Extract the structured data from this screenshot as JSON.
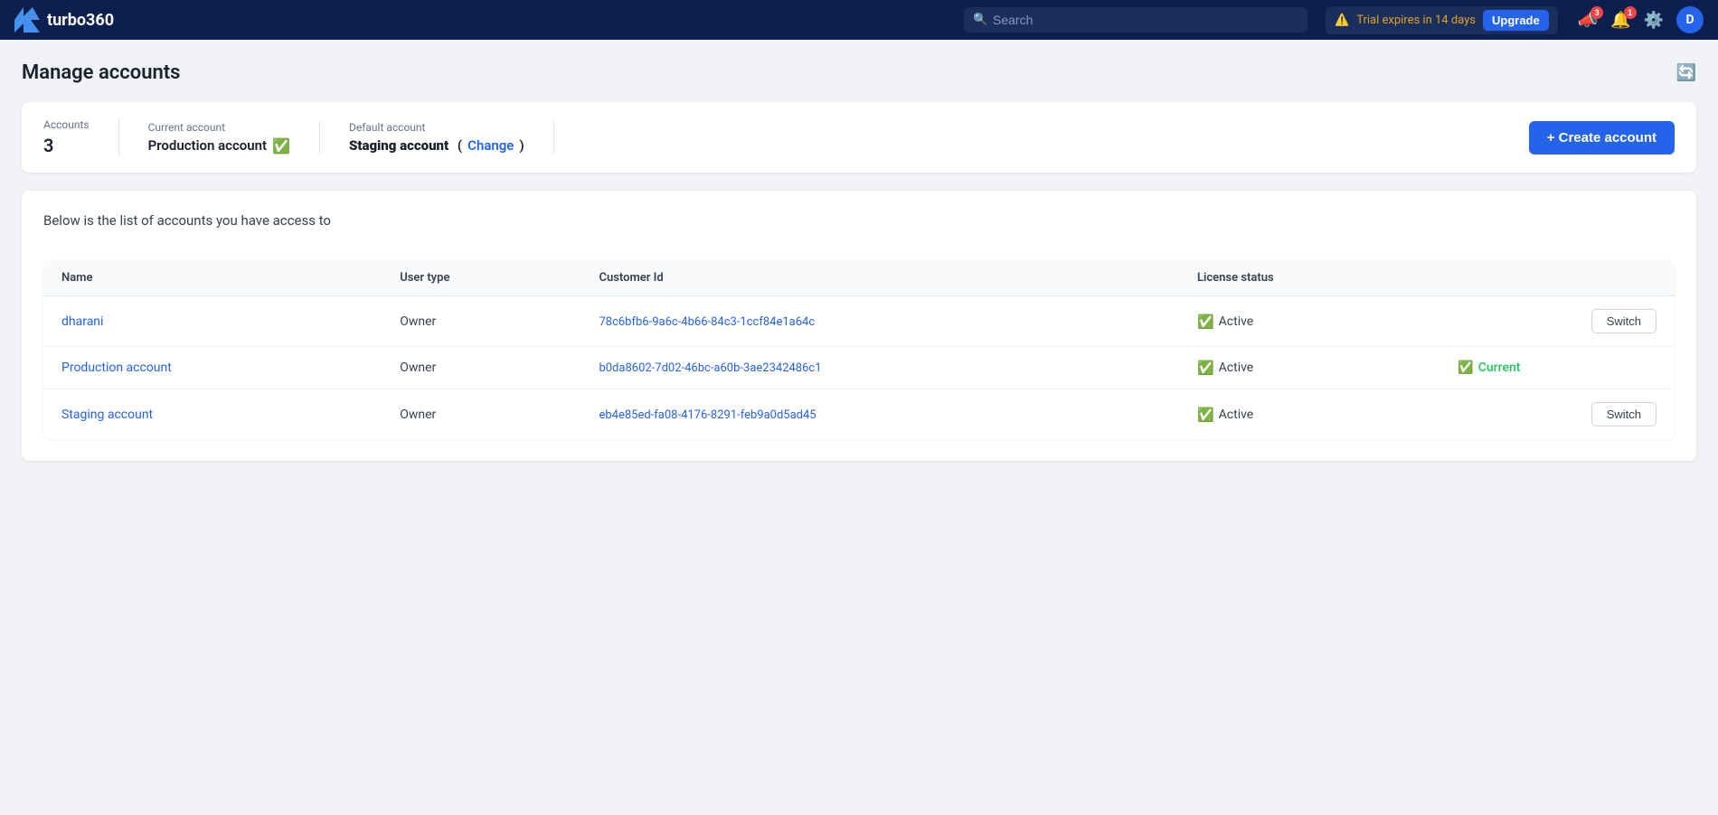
{
  "header": {
    "logo_text": "turbo360",
    "search_placeholder": "Search",
    "trial_text": "Trial expires in 14 days",
    "upgrade_label": "Upgrade",
    "notifications_count": "3",
    "alerts_count": "1",
    "user_initial": "D"
  },
  "page": {
    "title": "Manage accounts",
    "subheader": "Below is the list of accounts you have access to",
    "create_account_label": "+ Create account",
    "info_bar": {
      "accounts_label": "Accounts",
      "accounts_value": "3",
      "current_account_label": "Current account",
      "current_account_value": "Production account",
      "default_account_label": "Default account",
      "default_account_value": "Staging account",
      "change_label": "Change"
    },
    "table": {
      "columns": [
        "Name",
        "User type",
        "Customer Id",
        "License status"
      ],
      "rows": [
        {
          "name": "dharani",
          "user_type": "Owner",
          "customer_id": "78c6bfb6-9a6c-4b66-84c3-1ccf84e1a64c",
          "license_status": "Active",
          "action": "Switch",
          "is_current": false
        },
        {
          "name": "Production account",
          "user_type": "Owner",
          "customer_id": "b0da8602-7d02-46bc-a60b-3ae2342486c1",
          "license_status": "Active",
          "action": "Current",
          "is_current": true
        },
        {
          "name": "Staging account",
          "user_type": "Owner",
          "customer_id": "eb4e85ed-fa08-4176-8291-feb9a0d5ad45",
          "license_status": "Active",
          "action": "Switch",
          "is_current": false
        }
      ]
    }
  }
}
